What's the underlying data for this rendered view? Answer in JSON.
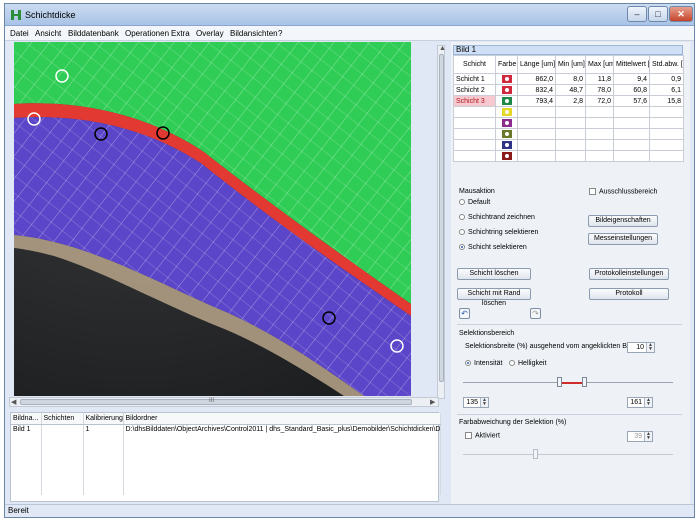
{
  "window": {
    "title": "Schichtdicke",
    "minimize": "–",
    "maximize": "□",
    "close": "✕"
  },
  "menu": [
    "Datei",
    "Ansicht",
    "Bilddatenbank",
    "Operationen",
    "Extra",
    "Overlay",
    "Bildansichten",
    "?"
  ],
  "image_panel": {
    "scroll_label": "III"
  },
  "layer_table": {
    "title": "Bild 1",
    "headers": [
      "Schicht",
      "Farbe",
      "Länge [um]",
      "Min [um]",
      "Max [um]",
      "Mittelwert [um]",
      "Std.abw. [um]"
    ],
    "rows": [
      {
        "name": "Schicht 1",
        "color": "#d0283c",
        "length": "862,0",
        "min": "8,0",
        "max": "11,8",
        "mean": "9,4",
        "std": "0,9"
      },
      {
        "name": "Schicht 2",
        "color": "#d0283c",
        "length": "832,4",
        "min": "48,7",
        "max": "78,0",
        "mean": "60,8",
        "std": "6,1"
      },
      {
        "name": "Schicht 3",
        "color": "#1f8a47",
        "length": "793,4",
        "min": "2,8",
        "max": "72,0",
        "mean": "57,6",
        "std": "15,8"
      }
    ],
    "empty_colors": [
      "#e4d828",
      "#8b2c8e",
      "#6b7a2a",
      "#2f3486",
      "#8a1a1a"
    ]
  },
  "mouse_action": {
    "title": "Mausaktion",
    "options": [
      "Default",
      "Schichtrand zeichnen",
      "Schichtring selektieren",
      "Schicht selektieren"
    ],
    "selected": 3
  },
  "ausschluss": "Ausschlussbereich",
  "buttons": {
    "bildeigenschaften": "Bildeigenschaften",
    "messeinstellungen": "Messeinstellungen",
    "schicht_loeschen": "Schicht löschen",
    "schicht_rand_loeschen": "Schicht mit Rand löschen",
    "protokolleinstellungen": "Protokolleinstellungen",
    "protokoll": "Protokoll"
  },
  "selection": {
    "title": "Selektionsbereich",
    "breite_label": "Selektionsbreite (%) ausgehend vom angeklickten Bildpunkt:",
    "breite_value": "10",
    "intensitaet": "Intensität",
    "helligkeit": "Helligkeit",
    "low": "135",
    "high": "161"
  },
  "color_dev": {
    "title": "Farbabweichung der Selektion (%)",
    "aktiviert": "Aktiviert",
    "value": "39"
  },
  "files": {
    "headers": [
      "Bildna...",
      "Schichten",
      "Kalibrierung",
      "Bildordner"
    ],
    "rows": [
      {
        "name": "Bild 1",
        "layers": "",
        "calibration": "1",
        "folder": "D:\\dhsBilddaten\\ObjectArchives\\Control2011 | dhs_Standard_Basic_plus\\Demobilder\\Schichtdicken\\Demo"
      }
    ]
  },
  "status": "Bereit"
}
